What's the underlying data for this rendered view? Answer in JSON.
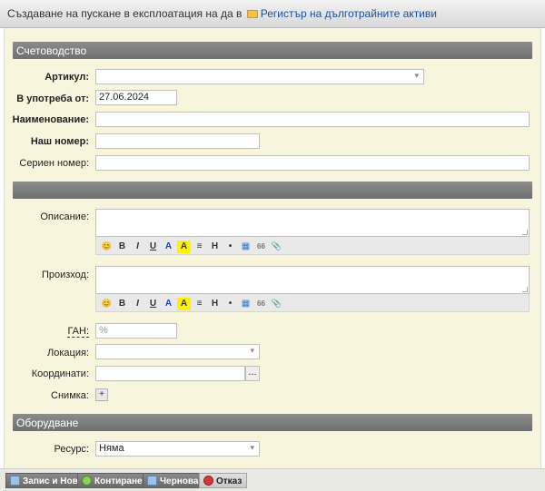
{
  "title": {
    "prefix": "Създаване на пускане в експлоатация на да в",
    "link": "Регистър на дълготрайните активи"
  },
  "sections": {
    "accounting": "Счетоводство",
    "blank": "",
    "equipment": "Оборудване"
  },
  "fields": {
    "article_label": "Артикул:",
    "in_use_label": "В употреба от:",
    "in_use_value": "27.06.2024",
    "name_label": "Наименование:",
    "our_number_label": "Наш номер:",
    "serial_label": "Сериен номер:",
    "description_label": "Описание:",
    "origin_label": "Произход:",
    "gan_label": "ГАН:",
    "gan_placeholder": "%",
    "location_label": "Локация:",
    "coordinates_label": "Координати:",
    "coordinates_button": "...",
    "photo_label": "Снимка:",
    "photo_button": "+",
    "resource_label": "Ресурс:",
    "resource_value": "Няма"
  },
  "toolbar": {
    "emoji": "😊",
    "bold": "B",
    "italic": "I",
    "underline": "U",
    "color": "A",
    "highlight": "A",
    "align": "≡",
    "heading": "H",
    "bullet": "•",
    "table": "▦",
    "quote": "66",
    "attach": "📎"
  },
  "footer": {
    "save_new": "Запис и Нов",
    "post": "Контиране",
    "draft": "Чернова",
    "cancel": "Отказ"
  },
  "colors": {
    "panel_bg": "#f7f5dc",
    "section_bg": "#7d7d7d",
    "link": "#1a4fa0"
  }
}
